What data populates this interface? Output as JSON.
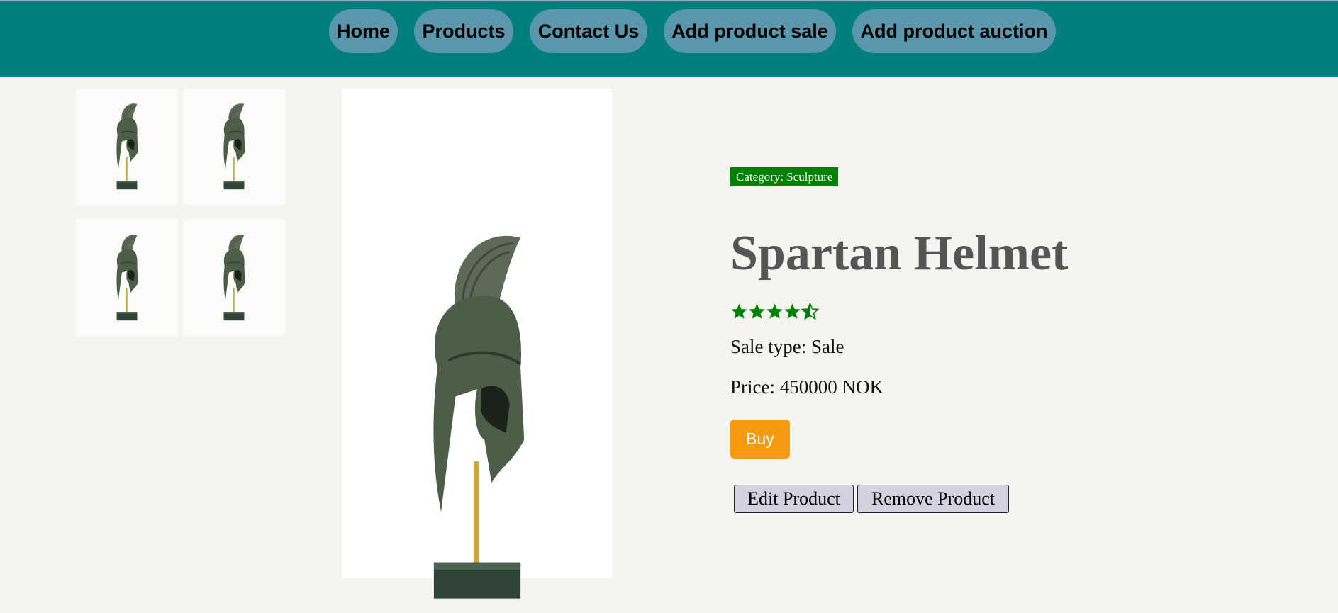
{
  "nav": {
    "items": [
      {
        "label": "Home"
      },
      {
        "label": "Products"
      },
      {
        "label": "Contact Us"
      },
      {
        "label": "Add product sale"
      },
      {
        "label": "Add product auction"
      }
    ]
  },
  "product": {
    "category_label": "Category: Sculpture",
    "title": "Spartan Helmet",
    "rating": 4.5,
    "rating_max": 5,
    "sale_type": "Sale type: Sale",
    "price": "Price: 450000 NOK",
    "buy_label": "Buy",
    "edit_label": "Edit Product",
    "remove_label": "Remove Product"
  },
  "colors": {
    "nav_bg": "#007f80",
    "nav_button": "#5a97ad",
    "category_bg": "#008000",
    "buy_bg": "#f79a12",
    "star": "#008000"
  }
}
